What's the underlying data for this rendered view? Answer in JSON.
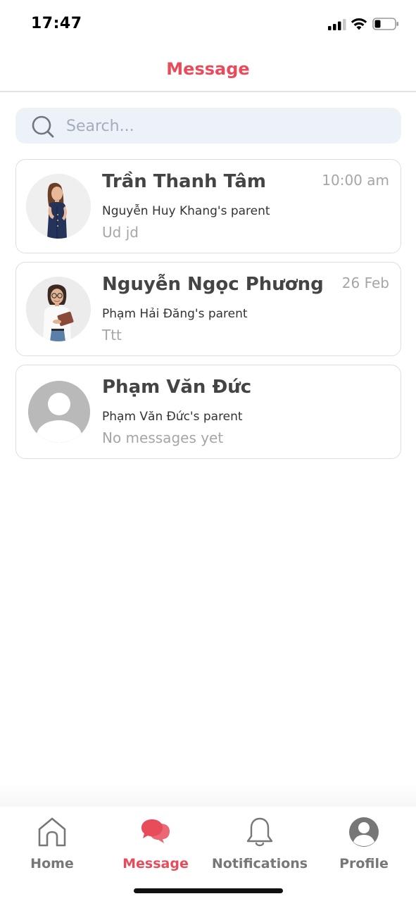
{
  "status_bar": {
    "time": "17:47"
  },
  "header": {
    "title": "Message"
  },
  "search": {
    "placeholder": "Search..."
  },
  "conversations": [
    {
      "name": "Trần Thanh Tâm",
      "time": "10:00 am",
      "subtitle": "Nguyễn Huy Khang's parent",
      "last_message": "Ud jd",
      "avatar": "photo-woman-navy-dress"
    },
    {
      "name": "Nguyễn Ngọc Phương",
      "time": "26 Feb",
      "subtitle": "Phạm Hải Đăng's parent",
      "last_message": "Ttt",
      "avatar": "photo-woman-glasses-tablet"
    },
    {
      "name": "Phạm Văn Đức",
      "time": "",
      "subtitle": "Phạm Văn Đức's parent",
      "last_message": "No messages yet",
      "avatar": "default-user-icon"
    }
  ],
  "bottom_nav": [
    {
      "label": "Home",
      "icon": "home-icon",
      "active": false
    },
    {
      "label": "Message",
      "icon": "chat-bubbles-icon",
      "active": true
    },
    {
      "label": "Notifications",
      "icon": "bell-icon",
      "active": false
    },
    {
      "label": "Profile",
      "icon": "user-circle-icon",
      "active": false
    }
  ],
  "colors": {
    "accent": "#e84c5a",
    "search_bg": "#edf2f9",
    "muted_text": "#a6a6a6"
  }
}
